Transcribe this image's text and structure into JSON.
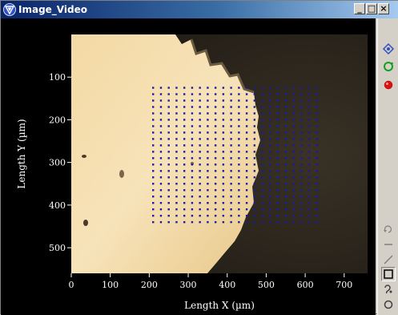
{
  "window": {
    "title": "Image_Video",
    "minimize_label": "_",
    "maximize_label": "□",
    "close_label": "×"
  },
  "chart_data": {
    "type": "scatter",
    "title": "",
    "xlabel": "Length X (µm)",
    "ylabel": "Length Y (µm)",
    "xlim": [
      0,
      760
    ],
    "ylim": [
      560,
      0
    ],
    "x_ticks": [
      "0",
      "100",
      "200",
      "300",
      "400",
      "500",
      "600",
      "700"
    ],
    "x_tick_values": [
      0,
      100,
      200,
      300,
      400,
      500,
      600,
      700
    ],
    "y_ticks": [
      "100",
      "200",
      "300",
      "400",
      "500"
    ],
    "y_tick_values": [
      100,
      200,
      300,
      400,
      500
    ],
    "grid": false,
    "marker_color": "#1a1aa8",
    "series": [
      {
        "x_start": 210,
        "x_end": 630,
        "x_step": 20,
        "y_start": 125,
        "y_end": 450,
        "y_step": 15
      }
    ]
  },
  "toolbar": {
    "tools": [
      {
        "name": "navigate-icon",
        "color": "#3050c0"
      },
      {
        "name": "refresh-icon",
        "color": "#10a020"
      },
      {
        "name": "record-icon",
        "color": "#e01010"
      },
      {
        "name": "rotate-icon",
        "color": "#808080"
      },
      {
        "name": "line-h-icon",
        "color": "#808080"
      },
      {
        "name": "line-diag-icon",
        "color": "#808080"
      },
      {
        "name": "rectangle-icon",
        "color": "#000000"
      },
      {
        "name": "freehand-icon",
        "color": "#404040"
      },
      {
        "name": "circle-icon",
        "color": "#404040"
      }
    ]
  }
}
